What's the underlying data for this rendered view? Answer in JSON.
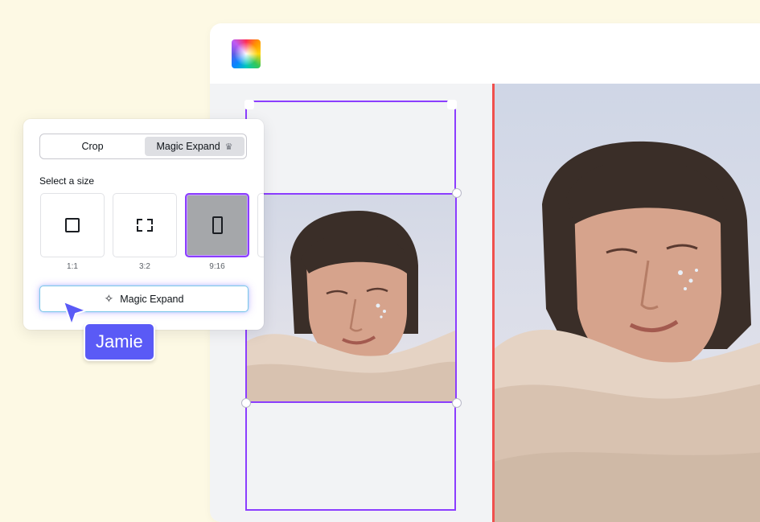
{
  "panel": {
    "tabs": [
      {
        "label": "Crop",
        "active": false
      },
      {
        "label": "Magic Expand",
        "active": true,
        "icon": "crown-icon"
      }
    ],
    "size_heading": "Select a size",
    "sizes": [
      {
        "ratio": "1:1",
        "icon": "square-icon",
        "selected": false
      },
      {
        "ratio": "3:2",
        "icon": "expand-corners-icon",
        "selected": false
      },
      {
        "ratio": "9:16",
        "icon": "portrait-rect-icon",
        "selected": true
      }
    ],
    "action_button": {
      "label": "Magic Expand",
      "icon": "sparkle-icon"
    }
  },
  "collaborator": {
    "name": "Jamie",
    "color": "#5a5af6"
  },
  "colors": {
    "accent": "#8b3dff",
    "page_edge": "#f0504d",
    "background": "#fdf9e4"
  }
}
